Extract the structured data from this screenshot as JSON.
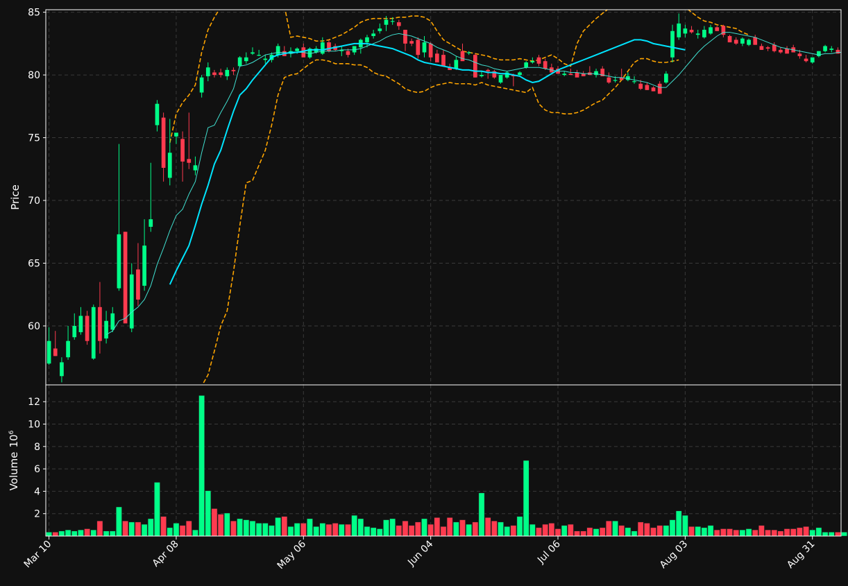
{
  "chart_data": {
    "type": "candlestick",
    "title": "",
    "colors": {
      "background": "#111111",
      "up": "#00ff88",
      "down": "#ff3b4f",
      "ma_fast": "#40e0d0",
      "ma_slow": "#00e5ff",
      "bands": "#ffa500",
      "grid": "#3a3a3a",
      "axis": "#ffffff"
    },
    "price_panel": {
      "ylabel": "Price",
      "ylim": [
        55.3,
        85.2
      ],
      "yticks": [
        60,
        65,
        70,
        75,
        80,
        85
      ]
    },
    "volume_panel": {
      "ylabel": "Volume",
      "ylabel_exponent": "10",
      "ylabel_power": "6",
      "ylim": [
        0,
        13.5
      ],
      "yticks": [
        2,
        4,
        6,
        8,
        10,
        12
      ]
    },
    "xaxis": {
      "ticks": [
        {
          "index": 0,
          "label": "Mar 10"
        },
        {
          "index": 20,
          "label": "Apr 08"
        },
        {
          "index": 40,
          "label": "May 06"
        },
        {
          "index": 60,
          "label": "Jun 04"
        },
        {
          "index": 80,
          "label": "Jul 06"
        },
        {
          "index": 100,
          "label": "Aug 03"
        },
        {
          "index": 120,
          "label": "Aug 31"
        }
      ]
    },
    "ohlc": [
      [
        57.0,
        59.9,
        56.9,
        58.8
      ],
      [
        58.2,
        59.6,
        57.6,
        57.6
      ],
      [
        56.0,
        57.5,
        55.5,
        57.1
      ],
      [
        57.5,
        60.0,
        57.3,
        58.8
      ],
      [
        59.1,
        61.0,
        58.9,
        60.0
      ],
      [
        59.5,
        61.5,
        59.3,
        60.8
      ],
      [
        60.8,
        61.2,
        58.5,
        58.8
      ],
      [
        57.4,
        61.7,
        57.3,
        61.5
      ],
      [
        61.5,
        63.5,
        57.8,
        58.8
      ],
      [
        59.0,
        61.2,
        58.6,
        60.4
      ],
      [
        59.7,
        61.5,
        59.5,
        61.0
      ],
      [
        63.0,
        74.5,
        62.8,
        67.3
      ],
      [
        67.5,
        67.5,
        60.5,
        60.2
      ],
      [
        59.8,
        65.0,
        59.5,
        64.1
      ],
      [
        64.5,
        66.6,
        61.6,
        62.1
      ],
      [
        63.2,
        68.5,
        62.8,
        66.4
      ],
      [
        67.9,
        73.0,
        67.5,
        68.5
      ],
      [
        76.0,
        78.0,
        75.5,
        77.7
      ],
      [
        76.6,
        77.0,
        71.5,
        72.6
      ],
      [
        71.8,
        76.5,
        71.2,
        73.8
      ],
      [
        75.1,
        75.2,
        74.5,
        75.4
      ],
      [
        74.9,
        75.5,
        71.5,
        73.1
      ],
      [
        73.3,
        77.0,
        72.5,
        73.0
      ],
      [
        72.4,
        73.5,
        72.0,
        72.8
      ],
      [
        78.6,
        80.0,
        78.2,
        79.8
      ],
      [
        79.9,
        81.0,
        79.5,
        80.6
      ],
      [
        80.2,
        80.4,
        79.8,
        80.0
      ],
      [
        80.2,
        80.5,
        79.8,
        80.0
      ],
      [
        79.9,
        80.6,
        79.6,
        80.4
      ],
      [
        80.4,
        80.6,
        80.0,
        80.3
      ],
      [
        80.7,
        81.5,
        80.6,
        81.4
      ],
      [
        81.1,
        81.8,
        80.9,
        81.4
      ],
      [
        81.7,
        82.2,
        81.6,
        81.8
      ],
      [
        81.6,
        82.0,
        81.5,
        81.6
      ],
      [
        81.2,
        81.6,
        80.9,
        81.3
      ],
      [
        81.2,
        81.8,
        81.0,
        81.6
      ],
      [
        81.6,
        82.5,
        81.4,
        82.3
      ],
      [
        81.9,
        82.3,
        81.5,
        81.5
      ],
      [
        81.7,
        82.2,
        81.4,
        81.9
      ],
      [
        81.9,
        82.2,
        81.7,
        82.1
      ],
      [
        82.2,
        82.5,
        81.7,
        81.4
      ],
      [
        81.4,
        82.2,
        81.3,
        82.1
      ],
      [
        81.8,
        82.3,
        81.7,
        82.1
      ],
      [
        81.7,
        83.0,
        81.6,
        82.6
      ],
      [
        82.6,
        82.8,
        81.8,
        81.9
      ],
      [
        82.3,
        82.5,
        81.9,
        82.0
      ],
      [
        81.9,
        82.3,
        81.5,
        82.0
      ],
      [
        81.9,
        82.1,
        81.4,
        81.6
      ],
      [
        81.8,
        82.3,
        81.6,
        82.3
      ],
      [
        82.2,
        82.9,
        81.7,
        82.8
      ],
      [
        82.6,
        83.2,
        82.2,
        83.0
      ],
      [
        83.1,
        83.6,
        82.9,
        83.3
      ],
      [
        83.5,
        84.1,
        83.3,
        83.7
      ],
      [
        84.0,
        84.7,
        83.5,
        84.4
      ],
      [
        84.3,
        84.6,
        84.0,
        84.3
      ],
      [
        84.2,
        84.4,
        83.6,
        83.9
      ],
      [
        83.6,
        83.6,
        81.9,
        82.5
      ],
      [
        82.7,
        82.9,
        82.3,
        82.5
      ],
      [
        82.8,
        83.0,
        81.3,
        81.6
      ],
      [
        81.8,
        83.1,
        81.4,
        82.6
      ],
      [
        82.5,
        82.6,
        81.1,
        81.4
      ],
      [
        81.7,
        82.0,
        81.2,
        81.0
      ],
      [
        81.6,
        82.0,
        81.0,
        80.7
      ],
      [
        80.6,
        80.9,
        80.4,
        80.4
      ],
      [
        80.5,
        81.5,
        80.4,
        81.2
      ],
      [
        81.9,
        82.5,
        81.2,
        81.1
      ],
      [
        81.8,
        81.9,
        81.6,
        81.8
      ],
      [
        81.6,
        81.7,
        79.8,
        79.8
      ],
      [
        79.9,
        80.3,
        79.8,
        80.0
      ],
      [
        80.4,
        80.5,
        79.7,
        80.3
      ],
      [
        80.3,
        80.4,
        79.7,
        79.8
      ],
      [
        79.4,
        80.0,
        79.3,
        80.0
      ],
      [
        79.8,
        80.3,
        79.7,
        80.2
      ],
      [
        80.0,
        80.1,
        79.1,
        79.9
      ],
      [
        80.0,
        80.3,
        79.9,
        80.2
      ],
      [
        80.6,
        81.1,
        80.5,
        81.0
      ],
      [
        81.0,
        81.4,
        80.9,
        81.1
      ],
      [
        81.4,
        81.6,
        80.7,
        80.9
      ],
      [
        81.1,
        81.3,
        80.4,
        80.5
      ],
      [
        80.6,
        80.9,
        80.3,
        80.2
      ],
      [
        80.5,
        80.7,
        80.4,
        80.1
      ],
      [
        80.0,
        80.3,
        79.9,
        80.1
      ],
      [
        80.1,
        80.5,
        80.0,
        80.0
      ],
      [
        80.2,
        80.4,
        80.0,
        79.8
      ],
      [
        80.1,
        80.3,
        79.9,
        79.9
      ],
      [
        80.2,
        80.7,
        80.0,
        80.0
      ],
      [
        80.0,
        80.5,
        79.8,
        80.3
      ],
      [
        80.5,
        80.7,
        79.9,
        79.9
      ],
      [
        79.8,
        80.2,
        79.3,
        79.4
      ],
      [
        79.6,
        79.9,
        79.4,
        79.6
      ],
      [
        79.8,
        80.5,
        79.6,
        79.6
      ],
      [
        79.6,
        80.2,
        79.5,
        79.9
      ],
      [
        79.5,
        79.9,
        79.3,
        79.5
      ],
      [
        79.3,
        79.6,
        78.8,
        78.9
      ],
      [
        79.2,
        79.4,
        78.8,
        78.8
      ],
      [
        79.0,
        79.1,
        78.7,
        78.7
      ],
      [
        79.3,
        79.5,
        78.5,
        78.5
      ],
      [
        79.4,
        80.3,
        79.3,
        80.1
      ],
      [
        81.4,
        84.0,
        81.0,
        83.5
      ],
      [
        83.0,
        84.9,
        82.8,
        84.1
      ],
      [
        83.3,
        84.0,
        83.0,
        83.7
      ],
      [
        83.6,
        83.9,
        83.3,
        83.4
      ],
      [
        83.2,
        83.6,
        82.9,
        83.3
      ],
      [
        83.0,
        83.9,
        82.9,
        83.6
      ],
      [
        83.3,
        84.0,
        83.2,
        83.8
      ],
      [
        83.8,
        83.9,
        83.5,
        83.5
      ],
      [
        83.9,
        84.0,
        83.0,
        83.2
      ],
      [
        83.1,
        83.2,
        82.6,
        82.6
      ],
      [
        82.8,
        83.0,
        82.4,
        82.5
      ],
      [
        82.5,
        83.0,
        82.3,
        82.9
      ],
      [
        82.4,
        82.9,
        82.3,
        82.8
      ],
      [
        83.0,
        83.2,
        82.4,
        82.4
      ],
      [
        82.3,
        82.5,
        82.0,
        82.0
      ],
      [
        82.2,
        82.3,
        81.9,
        82.1
      ],
      [
        82.4,
        82.6,
        81.8,
        81.9
      ],
      [
        82.0,
        82.2,
        81.7,
        81.8
      ],
      [
        82.1,
        82.3,
        81.8,
        81.7
      ],
      [
        82.2,
        82.4,
        81.8,
        81.8
      ],
      [
        81.7,
        82.0,
        81.3,
        81.5
      ],
      [
        81.3,
        81.6,
        81.0,
        81.1
      ],
      [
        81.0,
        81.2,
        80.9,
        81.4
      ],
      [
        81.5,
        81.9,
        81.4,
        81.9
      ],
      [
        81.9,
        82.4,
        81.8,
        82.3
      ],
      [
        82.0,
        82.3,
        81.8,
        82.1
      ],
      [
        82.0,
        82.2,
        81.7,
        81.7
      ]
    ],
    "volume": [
      0.35,
      0.35,
      0.45,
      0.55,
      0.45,
      0.55,
      0.65,
      0.55,
      1.35,
      0.45,
      0.45,
      2.6,
      1.35,
      1.25,
      1.25,
      1.05,
      1.55,
      4.8,
      1.75,
      0.75,
      1.15,
      0.95,
      1.35,
      0.55,
      12.55,
      4.05,
      2.45,
      1.95,
      2.05,
      1.35,
      1.55,
      1.45,
      1.35,
      1.15,
      1.15,
      0.95,
      1.65,
      1.75,
      0.85,
      1.15,
      1.15,
      1.55,
      0.85,
      1.15,
      1.05,
      1.15,
      1.05,
      1.05,
      1.85,
      1.55,
      0.85,
      0.75,
      0.65,
      1.45,
      1.55,
      0.95,
      1.35,
      0.95,
      1.25,
      1.55,
      1.05,
      1.65,
      0.85,
      1.65,
      1.25,
      1.45,
      1.05,
      1.25,
      3.85,
      1.65,
      1.35,
      1.25,
      0.85,
      0.95,
      1.75,
      6.75,
      1.05,
      0.75,
      1.05,
      1.15,
      0.65,
      0.95,
      1.05,
      0.45,
      0.45,
      0.75,
      0.65,
      0.75,
      1.35,
      1.35,
      0.95,
      0.75,
      0.45,
      1.25,
      1.15,
      0.75,
      0.95,
      0.95,
      1.45,
      2.25,
      1.85,
      0.85,
      0.85,
      0.75,
      0.95,
      0.55,
      0.65,
      0.65,
      0.55,
      0.55,
      0.65,
      0.55,
      0.95,
      0.55,
      0.55,
      0.45,
      0.65,
      0.65,
      0.75,
      0.85,
      0.55,
      0.75,
      0.35,
      0.35,
      0.35,
      0.35,
      0.55
    ],
    "ma_fast": [
      null,
      null,
      null,
      null,
      null,
      null,
      null,
      null,
      null,
      59.3,
      59.6,
      60.4,
      60.6,
      61.1,
      61.5,
      62.1,
      63.2,
      64.9,
      66.2,
      67.6,
      68.8,
      69.3,
      70.5,
      71.5,
      73.8,
      75.8,
      76.0,
      77.0,
      77.9,
      78.9,
      80.7,
      80.8,
      81.0,
      81.3,
      81.6,
      81.7,
      81.8,
      81.8,
      81.7,
      81.8,
      81.8,
      81.7,
      81.8,
      81.9,
      81.9,
      81.9,
      82.0,
      82.0,
      82.0,
      82.1,
      82.3,
      82.5,
      82.7,
      83.0,
      83.2,
      83.3,
      83.2,
      83.1,
      82.9,
      82.7,
      82.5,
      82.2,
      82.0,
      81.8,
      81.5,
      81.3,
      81.2,
      81.0,
      80.8,
      80.7,
      80.5,
      80.4,
      80.3,
      80.4,
      80.5,
      80.6,
      80.6,
      80.6,
      80.5,
      80.4,
      80.3,
      80.3,
      80.2,
      80.2,
      80.1,
      80.1,
      80.1,
      80.0,
      79.9,
      79.8,
      79.8,
      79.7,
      79.6,
      79.5,
      79.4,
      79.2,
      79.0,
      79.0,
      79.5,
      80.0,
      80.6,
      81.2,
      81.8,
      82.3,
      82.7,
      83.1,
      83.4,
      83.4,
      83.3,
      83.2,
      83.1,
      83.0,
      82.8,
      82.6,
      82.4,
      82.2,
      82.1,
      82.0,
      81.9,
      81.8,
      81.7,
      81.6,
      81.7,
      81.7,
      81.8,
      81.8,
      81.8
    ],
    "ma_slow": [
      null,
      null,
      null,
      null,
      null,
      null,
      null,
      null,
      null,
      null,
      null,
      null,
      null,
      null,
      null,
      null,
      null,
      null,
      null,
      63.3,
      64.4,
      65.4,
      66.4,
      68.0,
      69.7,
      71.2,
      72.9,
      74.0,
      75.6,
      77.1,
      78.4,
      78.9,
      79.6,
      80.2,
      80.8,
      81.4,
      81.6,
      81.7,
      81.8,
      81.8,
      81.9,
      82.0,
      82.0,
      82.0,
      82.1,
      82.2,
      82.3,
      82.4,
      82.5,
      82.5,
      82.5,
      82.4,
      82.3,
      82.2,
      82.1,
      81.9,
      81.7,
      81.5,
      81.2,
      81.0,
      80.9,
      80.8,
      80.7,
      80.6,
      80.5,
      80.4,
      80.4,
      80.3,
      80.3,
      80.2,
      80.2,
      80.1,
      80.1,
      80.0,
      79.9,
      79.6,
      79.4,
      79.5,
      79.8,
      80.1,
      80.4,
      80.6,
      80.8,
      81.0,
      81.2,
      81.4,
      81.6,
      81.8,
      82.0,
      82.2,
      82.4,
      82.6,
      82.8,
      82.8,
      82.7,
      82.5,
      82.4,
      82.3,
      82.2,
      82.1,
      82.0
    ],
    "band_upper": [
      null,
      null,
      null,
      null,
      null,
      null,
      null,
      null,
      null,
      null,
      null,
      null,
      null,
      null,
      null,
      null,
      null,
      null,
      null,
      74.6,
      76.9,
      77.8,
      78.4,
      79.2,
      81.8,
      83.6,
      84.6,
      85.4,
      86.0,
      86.5,
      87.0,
      87.5,
      88.0,
      88.3,
      88.4,
      88.2,
      87.4,
      85.5,
      83.0,
      83.1,
      83.0,
      82.9,
      82.7,
      82.7,
      82.8,
      83.0,
      83.2,
      83.5,
      83.8,
      84.2,
      84.4,
      84.5,
      84.5,
      84.5,
      84.5,
      84.6,
      84.6,
      84.7,
      84.7,
      84.6,
      84.3,
      83.5,
      82.8,
      82.5,
      82.2,
      81.9,
      81.8,
      81.7,
      81.6,
      81.5,
      81.3,
      81.2,
      81.2,
      81.2,
      81.3,
      81.2,
      81.1,
      81.2,
      81.4,
      81.6,
      81.3,
      80.9,
      80.7,
      82.5,
      83.5,
      84.0,
      84.5,
      84.9,
      85.3,
      85.6,
      85.8,
      86.0,
      86.1,
      86.2,
      86.2,
      86.1,
      86.0,
      85.9,
      85.7,
      85.6,
      85.4,
      85.0,
      84.6,
      84.3,
      84.2,
      84.0,
      83.9,
      83.8,
      83.7,
      83.4,
      83.2
    ],
    "band_lower": [
      null,
      null,
      null,
      null,
      null,
      null,
      null,
      null,
      null,
      null,
      null,
      null,
      null,
      null,
      null,
      null,
      null,
      null,
      null,
      45.9,
      48.2,
      50.0,
      51.8,
      53.5,
      55.2,
      56.1,
      58.0,
      60.0,
      61.2,
      64.3,
      68.0,
      71.4,
      71.6,
      72.8,
      74.0,
      76.0,
      78.4,
      79.8,
      80.0,
      80.1,
      80.5,
      80.9,
      81.2,
      81.2,
      81.1,
      80.9,
      80.9,
      80.9,
      80.8,
      80.8,
      80.6,
      80.2,
      80.0,
      79.9,
      79.6,
      79.3,
      78.9,
      78.7,
      78.6,
      78.7,
      79.0,
      79.2,
      79.3,
      79.4,
      79.3,
      79.3,
      79.3,
      79.2,
      79.4,
      79.2,
      79.1,
      79.0,
      78.9,
      78.8,
      78.7,
      78.6,
      79.0,
      77.7,
      77.2,
      77.0,
      77.0,
      76.9,
      76.9,
      77.0,
      77.2,
      77.5,
      77.8,
      78.0,
      78.5,
      79.0,
      79.6,
      80.3,
      81.0,
      81.3,
      81.3,
      81.1,
      81.0,
      81.0,
      81.1,
      81.2
    ]
  }
}
